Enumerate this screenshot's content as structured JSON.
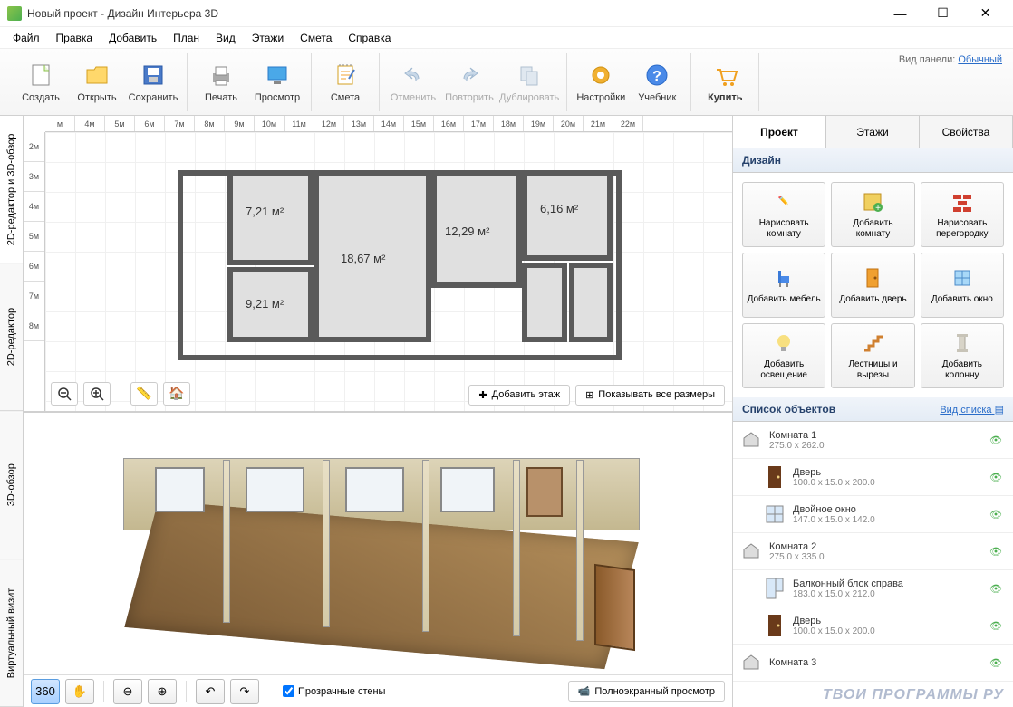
{
  "window": {
    "title": "Новый проект - Дизайн Интерьера 3D"
  },
  "menu": [
    "Файл",
    "Правка",
    "Добавить",
    "План",
    "Вид",
    "Этажи",
    "Смета",
    "Справка"
  ],
  "toolbar": {
    "create": "Создать",
    "open": "Открыть",
    "save": "Сохранить",
    "print": "Печать",
    "preview": "Просмотр",
    "estimate": "Смета",
    "undo": "Отменить",
    "redo": "Повторить",
    "duplicate": "Дублировать",
    "settings": "Настройки",
    "tutorial": "Учебник",
    "buy": "Купить"
  },
  "panel_mode": {
    "label": "Вид панели:",
    "value": "Обычный"
  },
  "vtabs": {
    "editor2d3d": "2D-редактор и 3D-обзор",
    "editor2d": "2D-редактор",
    "view3d": "3D-обзор",
    "virtual": "Виртуальный визит"
  },
  "ruler_h": [
    "м",
    "4м",
    "5м",
    "6м",
    "7м",
    "8м",
    "9м",
    "10м",
    "11м",
    "12м",
    "13м",
    "14м",
    "15м",
    "16м",
    "17м",
    "18м",
    "19м",
    "20м",
    "21м",
    "22м"
  ],
  "ruler_v": [
    "2м",
    "3м",
    "4м",
    "5м",
    "6м",
    "7м",
    "8м"
  ],
  "rooms": {
    "r1": "7,21 м²",
    "r2": "18,67 м²",
    "r3": "12,29 м²",
    "r4": "6,16 м²",
    "r5": "9,21 м²"
  },
  "canvas_btns": {
    "add_floor": "Добавить этаж",
    "show_dims": "Показывать все размеры"
  },
  "bottom": {
    "transparent": "Прозрачные стены",
    "fullscreen": "Полноэкранный просмотр"
  },
  "rp_tabs": {
    "project": "Проект",
    "floors": "Этажи",
    "props": "Свойства"
  },
  "sections": {
    "design": "Дизайн",
    "objects": "Список объектов",
    "list_mode": "Вид списка"
  },
  "tools": {
    "draw_room": "Нарисовать комнату",
    "add_room": "Добавить комнату",
    "draw_wall": "Нарисовать перегородку",
    "add_furn": "Добавить мебель",
    "add_door": "Добавить дверь",
    "add_window": "Добавить окно",
    "add_light": "Добавить освещение",
    "stairs": "Лестницы и вырезы",
    "add_column": "Добавить колонну"
  },
  "objects": [
    {
      "name": "Комната 1",
      "dim": "275.0 x 262.0",
      "indent": 0,
      "icon": "room"
    },
    {
      "name": "Дверь",
      "dim": "100.0 x 15.0 x 200.0",
      "indent": 1,
      "icon": "door"
    },
    {
      "name": "Двойное окно",
      "dim": "147.0 x 15.0 x 142.0",
      "indent": 1,
      "icon": "window"
    },
    {
      "name": "Комната 2",
      "dim": "275.0 x 335.0",
      "indent": 0,
      "icon": "room"
    },
    {
      "name": "Балконный блок справа",
      "dim": "183.0 x 15.0 x 212.0",
      "indent": 1,
      "icon": "balcony"
    },
    {
      "name": "Дверь",
      "dim": "100.0 x 15.0 x 200.0",
      "indent": 1,
      "icon": "door"
    },
    {
      "name": "Комната 3",
      "dim": "",
      "indent": 0,
      "icon": "room"
    }
  ],
  "watermark": "ТВОИ ПРОГРАММЫ РУ"
}
